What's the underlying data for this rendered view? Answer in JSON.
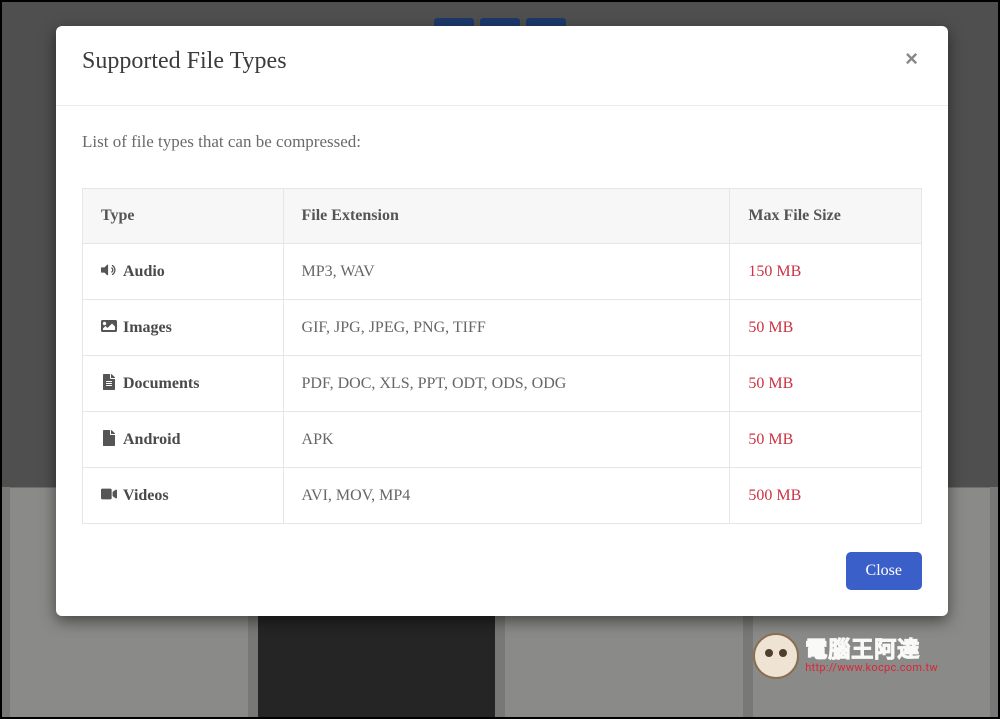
{
  "modal": {
    "title": "Supported File Types",
    "close_label": "×",
    "intro": "List of file types that can be compressed:",
    "close_button": "Close"
  },
  "table": {
    "headers": {
      "type": "Type",
      "ext": "File Extension",
      "size": "Max File Size"
    },
    "rows": [
      {
        "icon": "audio",
        "type": "Audio",
        "ext": "MP3, WAV",
        "size": "150 MB"
      },
      {
        "icon": "image",
        "type": "Images",
        "ext": "GIF, JPG, JPEG, PNG, TIFF",
        "size": "50 MB"
      },
      {
        "icon": "document",
        "type": "Documents",
        "ext": "PDF, DOC, XLS, PPT, ODT, ODS, ODG",
        "size": "50 MB"
      },
      {
        "icon": "android",
        "type": "Android",
        "ext": "APK",
        "size": "50 MB"
      },
      {
        "icon": "video",
        "type": "Videos",
        "ext": "AVI, MOV, MP4",
        "size": "500 MB"
      }
    ]
  },
  "watermark": {
    "cn": "電腦王阿達",
    "url": "http://www.kocpc.com.tw"
  }
}
